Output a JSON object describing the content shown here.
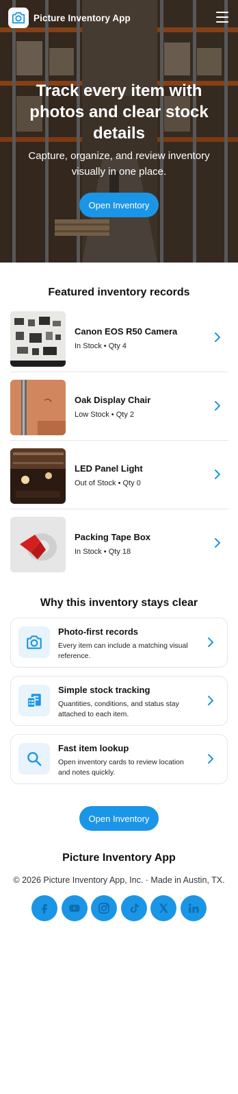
{
  "header": {
    "brand": "Picture Inventory App",
    "logo_icon": "camera-icon",
    "menu_icon": "hamburger-menu-icon"
  },
  "hero": {
    "title": "Track every item with photos and clear stock details",
    "subtitle": "Capture, organize, and review inventory visually in one place.",
    "cta_label": "Open Inventory"
  },
  "featured": {
    "title": "Featured inventory records",
    "items": [
      {
        "name": "Canon EOS R50 Camera",
        "meta": "In Stock • Qty 4",
        "icon": "chevron-right-icon"
      },
      {
        "name": "Oak Display Chair",
        "meta": "Low Stock • Qty 2",
        "icon": "chevron-right-icon"
      },
      {
        "name": "LED Panel Light",
        "meta": "Out of Stock • Qty 0",
        "icon": "chevron-right-icon"
      },
      {
        "name": "Packing Tape Box",
        "meta": "In Stock • Qty 18",
        "icon": "chevron-right-icon"
      }
    ]
  },
  "why": {
    "title": "Why this inventory stays clear",
    "cards": [
      {
        "title": "Photo-first records",
        "desc": "Every item can include a matching visual reference.",
        "icon": "camera-icon"
      },
      {
        "title": "Simple stock tracking",
        "desc": "Quantities, conditions, and status stay attached to each item.",
        "icon": "list-document-icon"
      },
      {
        "title": "Fast item lookup",
        "desc": "Open inventory cards to review location and notes quickly.",
        "icon": "search-icon"
      }
    ],
    "cta_label": "Open Inventory"
  },
  "footer": {
    "brand": "Picture Inventory App",
    "copyright": "© 2026 Picture Inventory App, Inc. · Made in Austin, TX.",
    "socials": [
      "facebook-icon",
      "youtube-icon",
      "instagram-icon",
      "tiktok-icon",
      "x-icon",
      "linkedin-icon"
    ]
  },
  "colors": {
    "accent": "#1b95e6",
    "icon_bg": "#e8f3fb",
    "text": "#111111"
  }
}
